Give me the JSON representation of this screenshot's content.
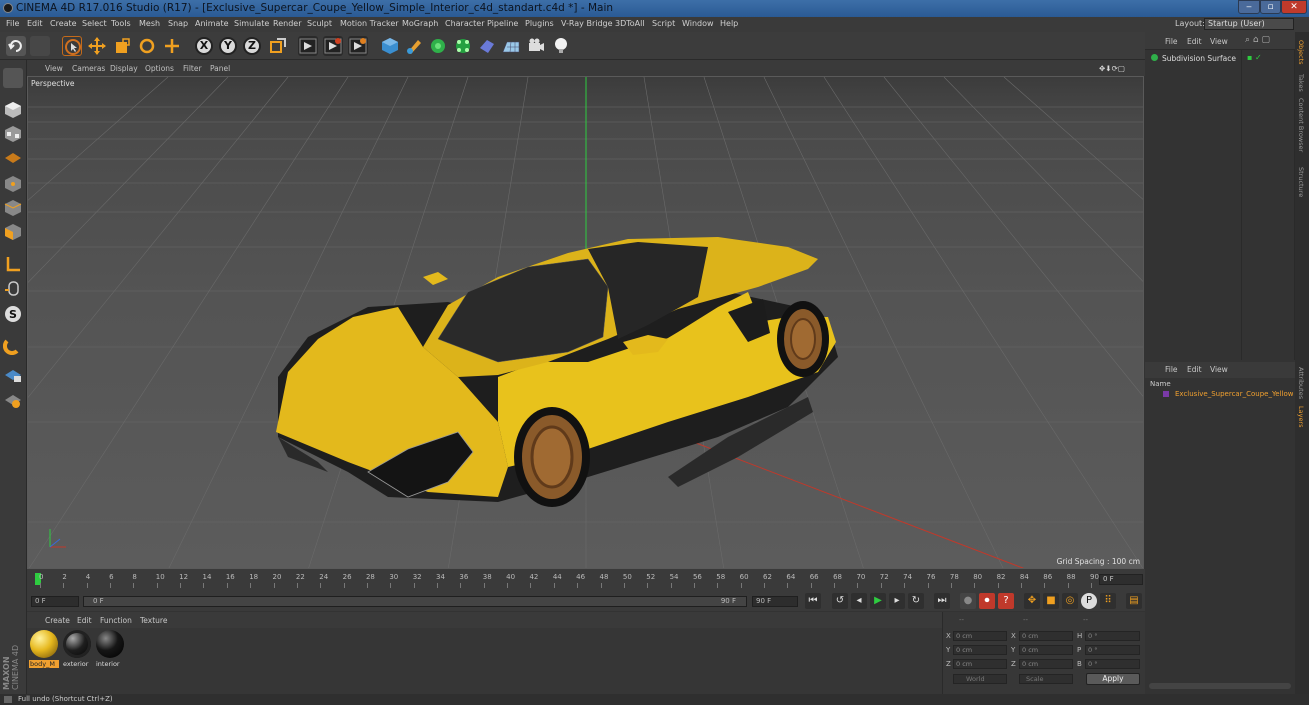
{
  "window": {
    "title": "CINEMA 4D R17.016 Studio (R17) - [Exclusive_Supercar_Coupe_Yellow_Simple_Interior_c4d_standart.c4d *] - Main"
  },
  "menu": {
    "items": [
      "File",
      "Edit",
      "Create",
      "Select",
      "Tools",
      "Mesh",
      "Snap",
      "Animate",
      "Simulate",
      "Render",
      "Sculpt",
      "Motion Tracker",
      "MoGraph",
      "Character",
      "Pipeline",
      "Plugins",
      "V-Ray Bridge",
      "3DToAll",
      "Script",
      "Window",
      "Help"
    ],
    "layout_label": "Layout:",
    "layout_value": "Startup (User)"
  },
  "toolbar": {
    "axis_x": "X",
    "axis_y": "Y",
    "axis_z": "Z"
  },
  "viewport": {
    "menu": [
      "View",
      "Cameras",
      "Display",
      "Options",
      "Filter",
      "Panel"
    ],
    "label": "Perspective",
    "grid_spacing": "Grid Spacing : 100 cm"
  },
  "timeline": {
    "ticks": [
      "0",
      "2",
      "4",
      "6",
      "8",
      "10",
      "12",
      "14",
      "16",
      "18",
      "20",
      "22",
      "24",
      "26",
      "28",
      "30",
      "32",
      "34",
      "36",
      "38",
      "40",
      "42",
      "44",
      "46",
      "48",
      "50",
      "52",
      "54",
      "56",
      "58",
      "60",
      "62",
      "64",
      "66",
      "68",
      "70",
      "72",
      "74",
      "76",
      "78",
      "80",
      "82",
      "84",
      "86",
      "88",
      "90"
    ],
    "current_frame": "0 F",
    "start_field": "0 F",
    "range_start": "0 F",
    "range_end": "90 F",
    "end_field": "90 F"
  },
  "materials": {
    "menu": [
      "Create",
      "Edit",
      "Function",
      "Texture"
    ],
    "items": [
      {
        "label": "body_M",
        "color": "#e6b81e"
      },
      {
        "label": "exterior",
        "color": "#1e1e1e"
      },
      {
        "label": "interior",
        "color": "#161616"
      }
    ]
  },
  "coords": {
    "header_dashes": [
      "--",
      "--",
      "--"
    ],
    "rows": [
      {
        "a": "X",
        "av": "0 cm",
        "b": "X",
        "bv": "0 cm",
        "c": "H",
        "cv": "0 °"
      },
      {
        "a": "Y",
        "av": "0 cm",
        "b": "Y",
        "bv": "0 cm",
        "c": "P",
        "cv": "0 °"
      },
      {
        "a": "Z",
        "av": "0 cm",
        "b": "Z",
        "bv": "0 cm",
        "c": "B",
        "cv": "0 °"
      }
    ],
    "space": "World",
    "mode": "Scale",
    "apply": "Apply"
  },
  "object_manager": {
    "menu": [
      "File",
      "Edit",
      "View"
    ],
    "objects": [
      "Subdivision Surface"
    ]
  },
  "attributes": {
    "menu": [
      "File",
      "Edit",
      "View"
    ],
    "name_header": "Name",
    "items": [
      "Exclusive_Supercar_Coupe_Yellow"
    ]
  },
  "side_tabs": [
    "Objects",
    "Takes",
    "Content Browser",
    "Structure",
    "Attributes",
    "Layers"
  ],
  "branding": {
    "maxon": "MAXON",
    "cinema": "CINEMA 4D"
  },
  "status": "Full undo (Shortcut Ctrl+Z)",
  "colors": {
    "accent": "#f0a030",
    "car_yellow": "#e8c21c",
    "bg": "#333333"
  }
}
